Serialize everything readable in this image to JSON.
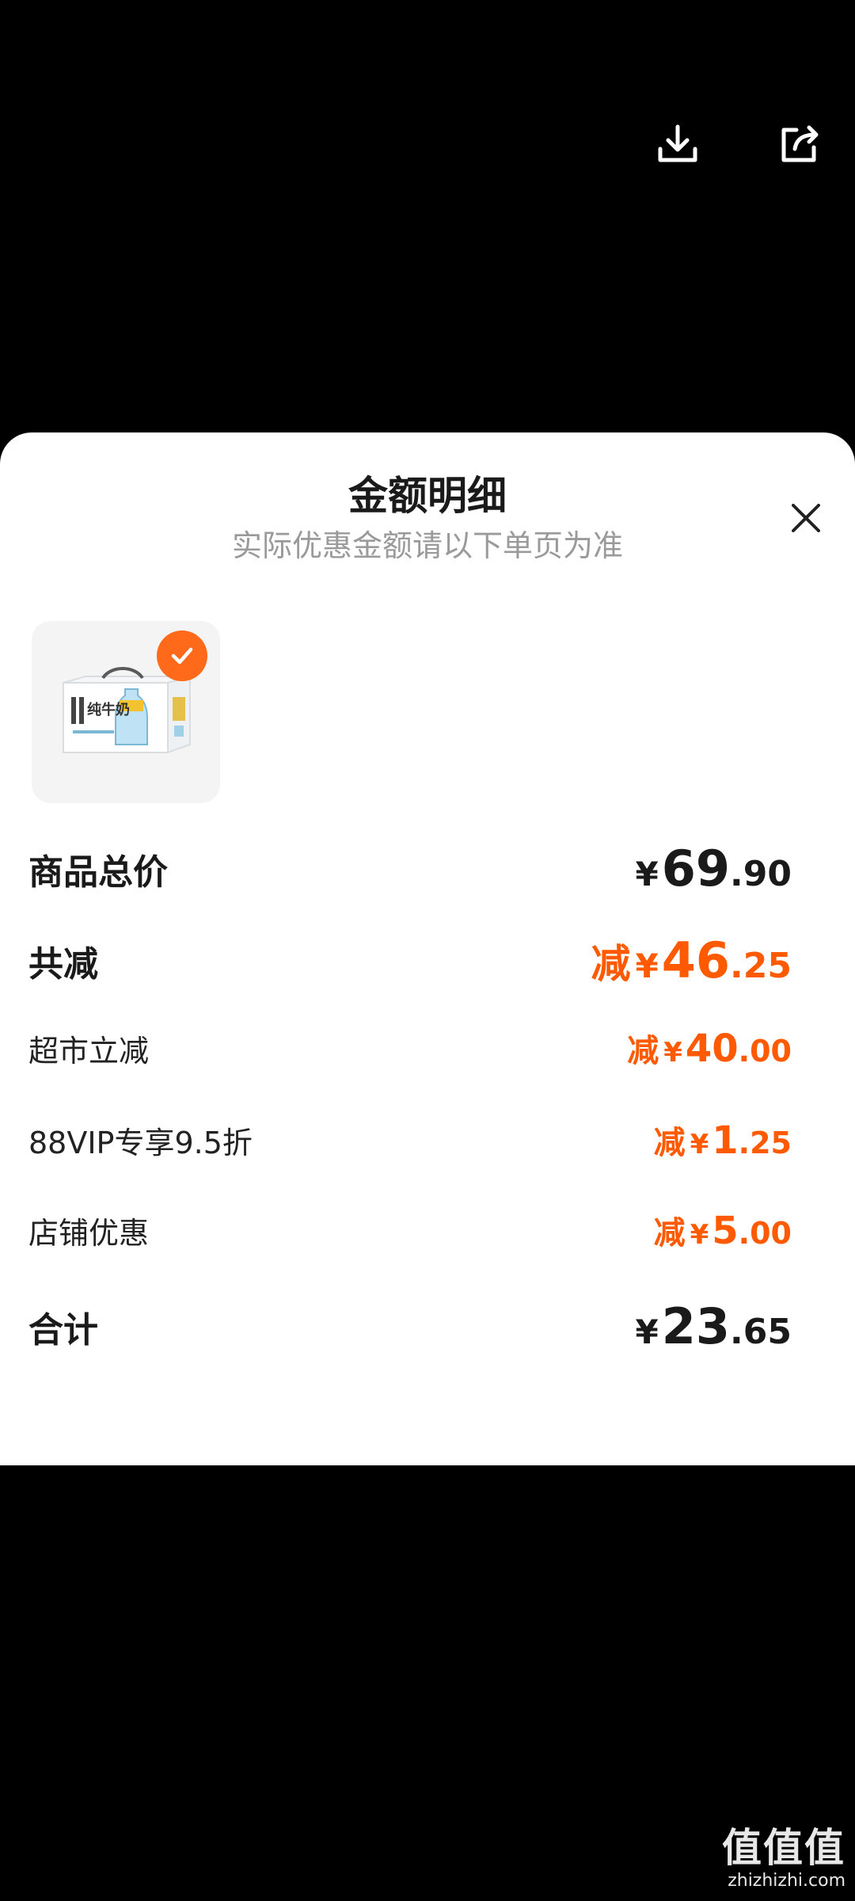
{
  "toolbar": {
    "download_icon": "download-icon",
    "share_icon": "share-icon"
  },
  "sheet": {
    "title": "金额明细",
    "subtitle": "实际优惠金额请以下单页为准",
    "close_icon": "close-icon"
  },
  "product": {
    "image": "milk-product-box",
    "selected": true,
    "selected_icon": "check-icon",
    "package_text": "纯牛奶"
  },
  "rows": [
    {
      "label": "商品总价",
      "prefix": "",
      "currency": "¥",
      "int": "69",
      "dec": ".90"
    },
    {
      "label": "共减",
      "prefix": "减",
      "currency": "¥",
      "int": "46",
      "dec": ".25"
    },
    {
      "label": "超市立减",
      "prefix": "减",
      "currency": "¥",
      "int": "40",
      "dec": ".00"
    },
    {
      "label": "88VIP专享9.5折",
      "prefix": "减",
      "currency": "¥",
      "int": "1",
      "dec": ".25"
    },
    {
      "label": "店铺优惠",
      "prefix": "减",
      "currency": "¥",
      "int": "5",
      "dec": ".00"
    },
    {
      "label": "合计",
      "prefix": "",
      "currency": "¥",
      "int": "23",
      "dec": ".65"
    }
  ],
  "colors": {
    "accent": "#ff5a00",
    "text": "#1a1a1a",
    "subtext": "#9a9a9a",
    "background": "#000000",
    "sheet": "#ffffff"
  },
  "watermark": {
    "brand": "值值值",
    "site": "zhizhizhi.com"
  }
}
